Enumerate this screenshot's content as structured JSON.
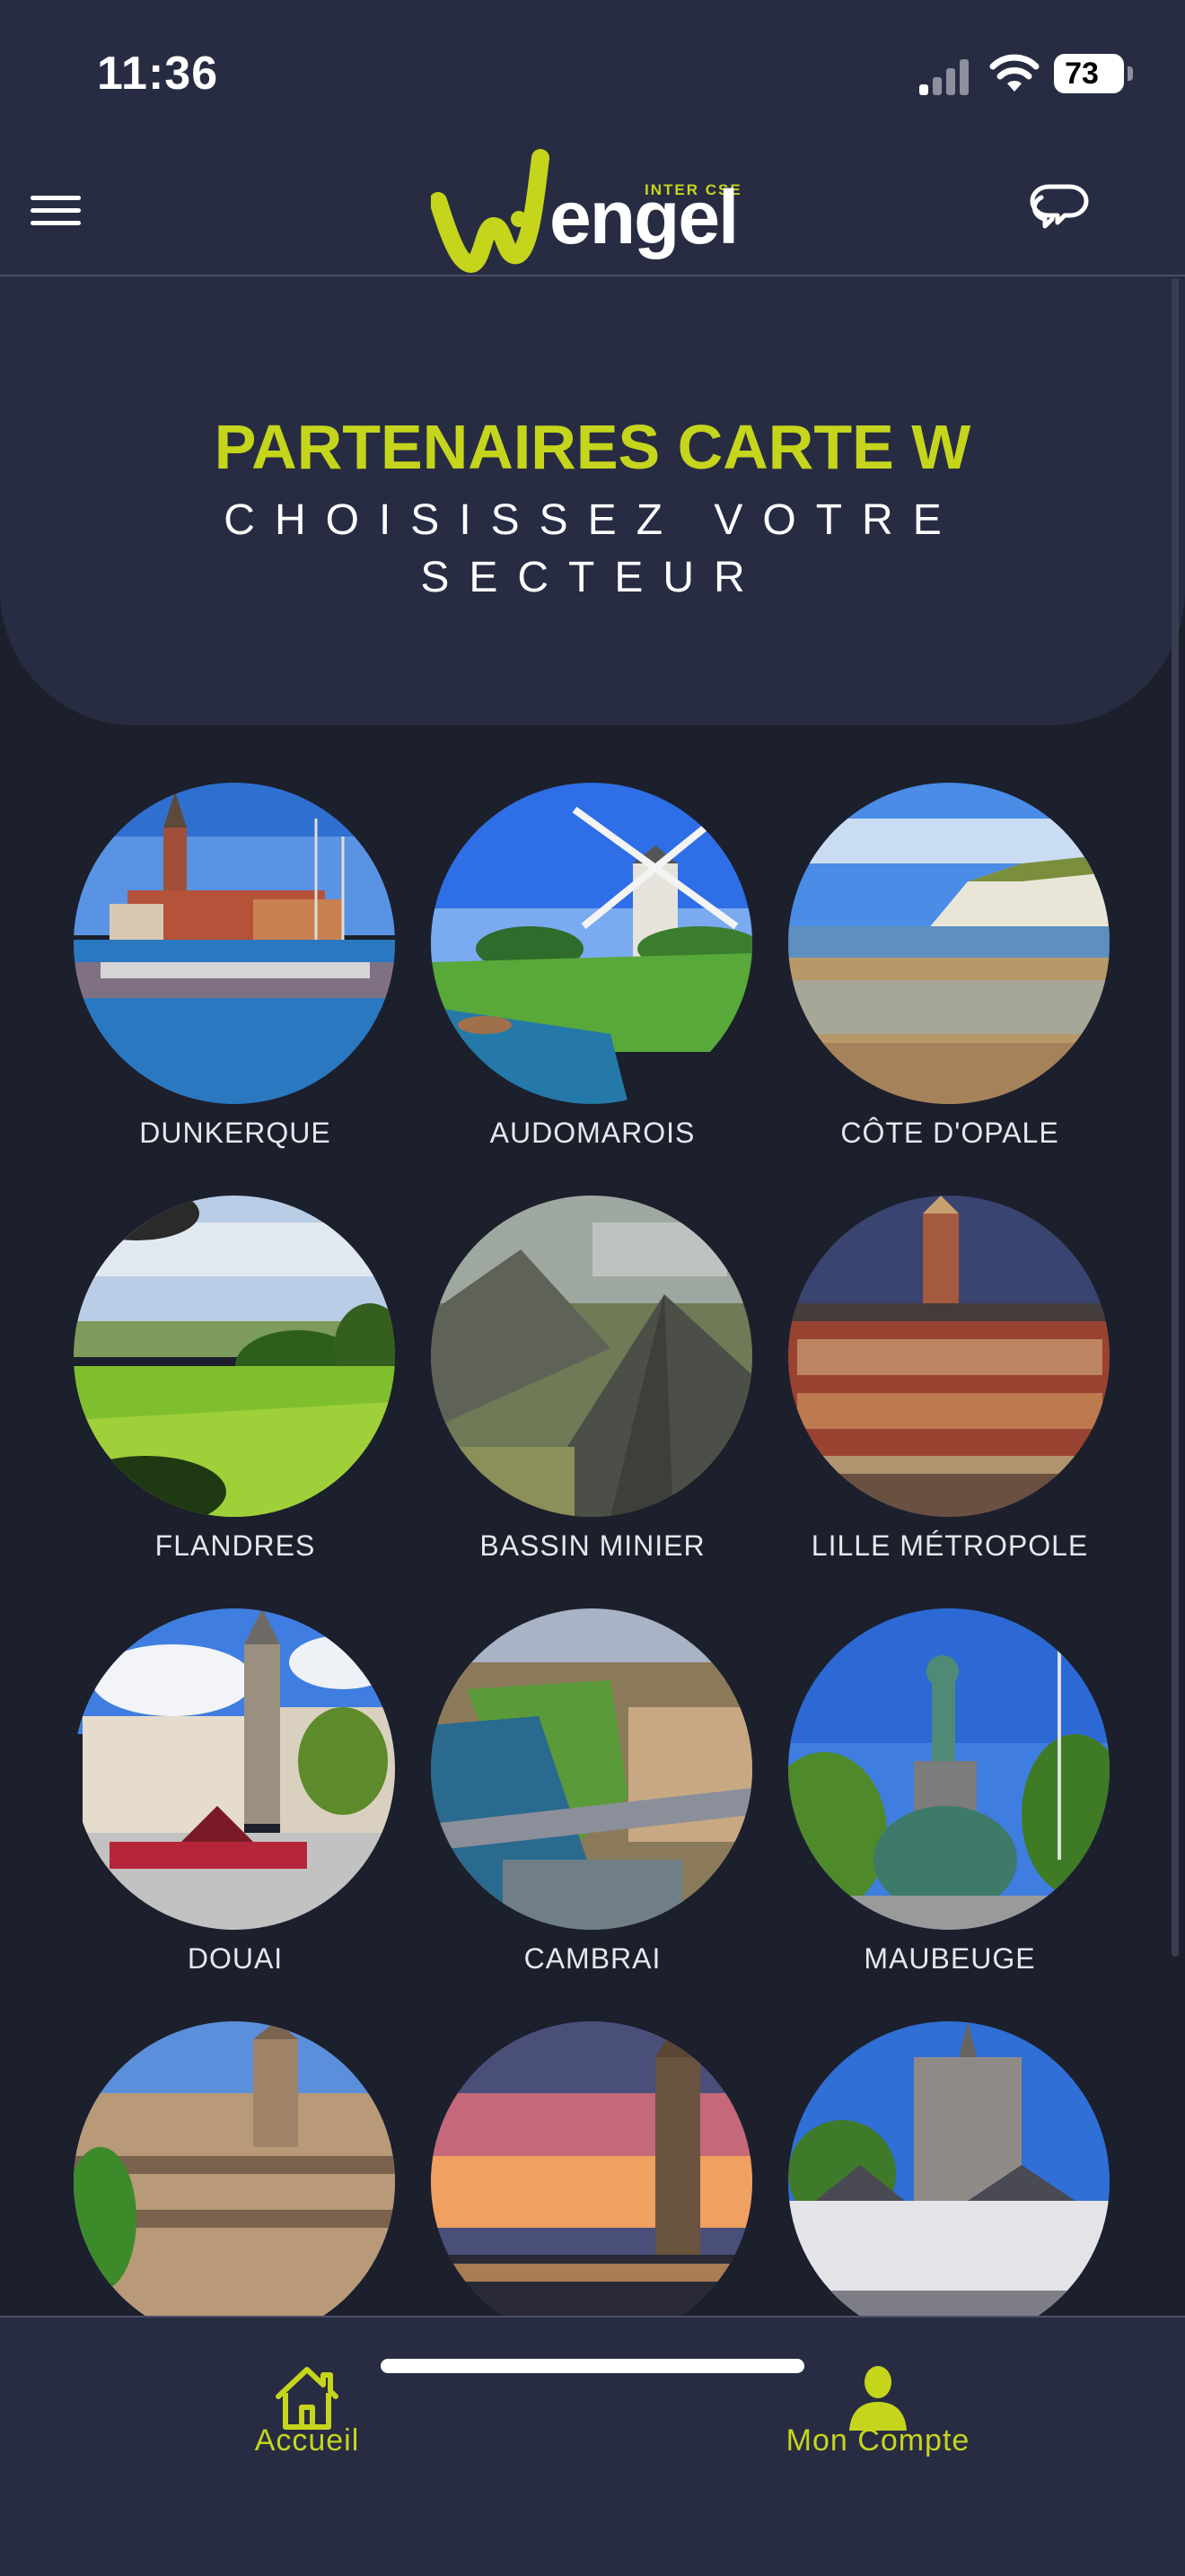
{
  "status": {
    "time": "11:36",
    "battery": "73"
  },
  "header": {
    "logo_sub": "INTER CSE",
    "logo_text": "engel"
  },
  "banner": {
    "title": "PARTENAIRES CARTE W",
    "subtitle": "CHOISISSEZ VOTRE SECTEUR"
  },
  "sectors": [
    {
      "label": "DUNKERQUE"
    },
    {
      "label": "AUDOMAROIS"
    },
    {
      "label": "CÔTE D'OPALE"
    },
    {
      "label": "FLANDRES"
    },
    {
      "label": "BASSIN MINIER"
    },
    {
      "label": "LILLE MÉTROPOLE"
    },
    {
      "label": "DOUAI"
    },
    {
      "label": "CAMBRAI"
    },
    {
      "label": "MAUBEUGE"
    },
    {
      "label": ""
    },
    {
      "label": ""
    },
    {
      "label": ""
    }
  ],
  "nav": {
    "home_label": "Accueil",
    "account_label": "Mon Compte"
  },
  "colors": {
    "accent": "#c5d51c",
    "header_bg": "#282c43",
    "page_bg": "#1c1f2c"
  }
}
